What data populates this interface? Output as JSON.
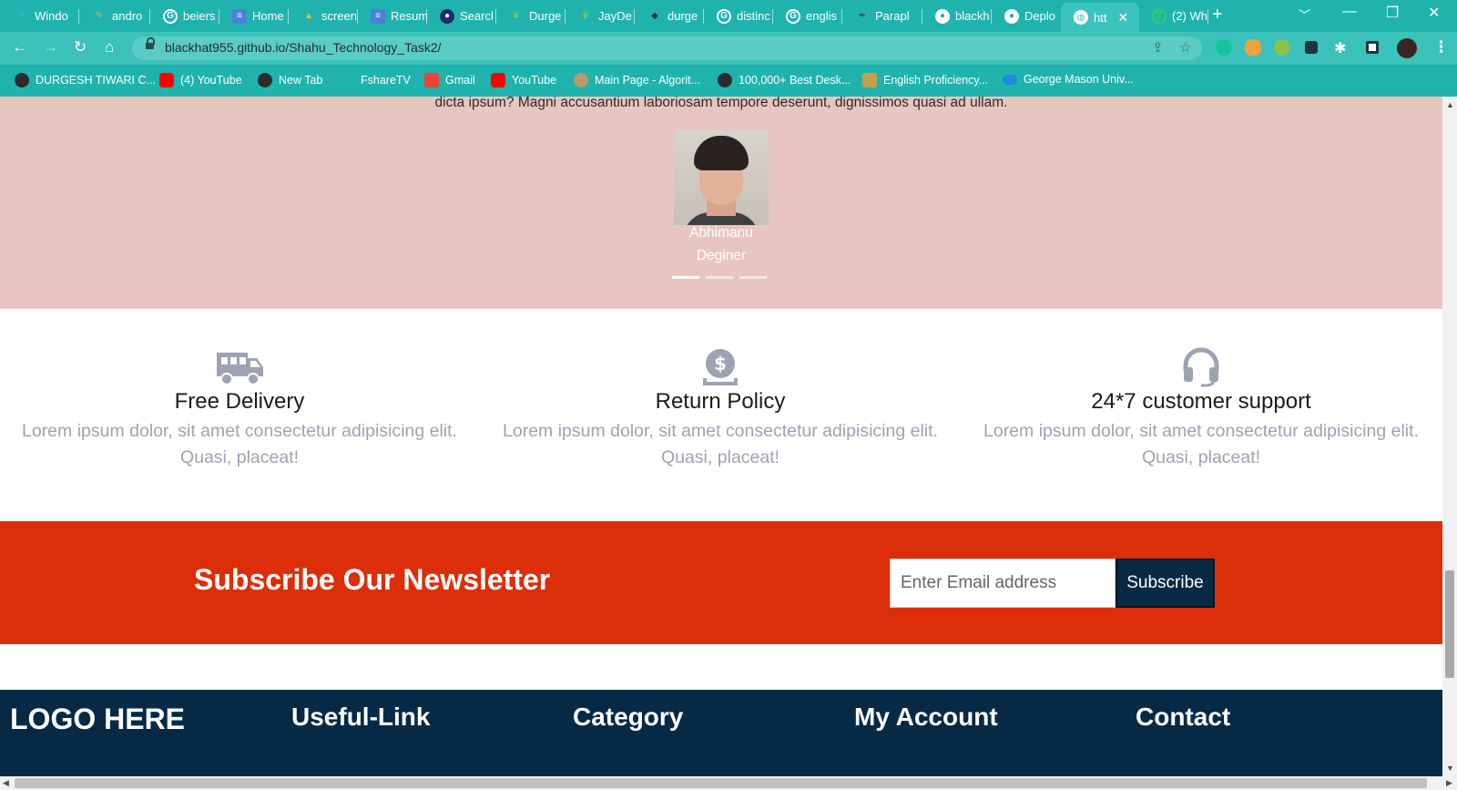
{
  "browser": {
    "tabs": [
      {
        "label": "Windo",
        "icon": "flutter-icon",
        "color": "#4fc3f7"
      },
      {
        "label": "andro",
        "icon": "android-studio-icon",
        "color": "#e0b060"
      },
      {
        "label": "beiers",
        "icon": "google-icon",
        "color": "#ffffff"
      },
      {
        "label": "Home",
        "icon": "google-docs-icon",
        "color": "#4a7fe0"
      },
      {
        "label": "screen",
        "icon": "google-drive-icon",
        "color": "#f4c20d"
      },
      {
        "label": "Resum",
        "icon": "google-docs-icon",
        "color": "#4a7fe0"
      },
      {
        "label": "Searcl",
        "icon": "search-site-icon",
        "color": "#1b2a6b"
      },
      {
        "label": "Durge",
        "icon": "leaf-icon",
        "color": "#8bc34a"
      },
      {
        "label": "JayDe",
        "icon": "leaf-icon",
        "color": "#8bc34a"
      },
      {
        "label": "durge",
        "icon": "stack-icon",
        "color": "#333333"
      },
      {
        "label": "distinc",
        "icon": "google-icon",
        "color": "#ffffff"
      },
      {
        "label": "englis",
        "icon": "google-icon",
        "color": "#ffffff"
      },
      {
        "label": "Parapl",
        "icon": "feather-icon",
        "color": "#444444"
      },
      {
        "label": "blackh",
        "icon": "github-icon",
        "color": "#ffffff"
      },
      {
        "label": "Deplo",
        "icon": "github-icon",
        "color": "#ffffff"
      },
      {
        "label": "htt",
        "icon": "globe-icon",
        "color": "#ffffff",
        "active": true
      },
      {
        "label": "(2) Wh",
        "icon": "whatsapp-icon",
        "color": "#25d366"
      }
    ],
    "new_tab": "+",
    "url": "blackhat955.github.io/Shahu_Technology_Task2/",
    "bookmarks": [
      {
        "label": "DURGESH TIWARI C...",
        "color": "#2b2b2b"
      },
      {
        "label": "(4) YouTube",
        "color": "#ff0000"
      },
      {
        "label": "New Tab",
        "color": "#2b2b2b"
      },
      {
        "label": "FshareTV",
        "color": "#20b3ad"
      },
      {
        "label": "Gmail",
        "color": "#ea4335"
      },
      {
        "label": "YouTube",
        "color": "#ff0000"
      },
      {
        "label": "Main Page - Algorit...",
        "color": "#b89a6a"
      },
      {
        "label": "100,000+ Best Desk...",
        "color": "#2b2b2b"
      },
      {
        "label": "English Proficiency...",
        "color": "#c5a04b"
      },
      {
        "label": "George Mason Univ...",
        "color": "#1e88e5"
      }
    ]
  },
  "testimonial": {
    "quote_tail": "dicta ipsum? Magni accusantium laboriosam tempore deserunt, dignissimos quasi ad ullam.",
    "name": "Abhimanu",
    "role": "Deginer",
    "dots": 3,
    "active_dot": 0
  },
  "features": [
    {
      "icon": "delivery-van-icon",
      "title": "Free Delivery",
      "desc": "Lorem ipsum dolor, sit amet consectetur adipisicing elit. Quasi, placeat!"
    },
    {
      "icon": "money-return-icon",
      "title": "Return Policy",
      "desc": "Lorem ipsum dolor, sit amet consectetur adipisicing elit. Quasi, placeat!"
    },
    {
      "icon": "headset-icon",
      "title": "24*7 customer support",
      "desc": "Lorem ipsum dolor, sit amet consectetur adipisicing elit. Quasi, placeat!"
    }
  ],
  "newsletter": {
    "title": "Subscribe Our Newsletter",
    "placeholder": "Enter Email address",
    "button": "Subscribe"
  },
  "footer": {
    "logo": "LOGO HERE",
    "headings": [
      "Useful-Link",
      "Category",
      "My Account",
      "Contact"
    ]
  },
  "colors": {
    "browser_teal": "#20b3ad",
    "testimonial_bg": "#e9c5bf",
    "newsletter_bg": "#dd2e0a",
    "footer_bg": "#062a45",
    "feature_desc": "#9ea3b3"
  }
}
